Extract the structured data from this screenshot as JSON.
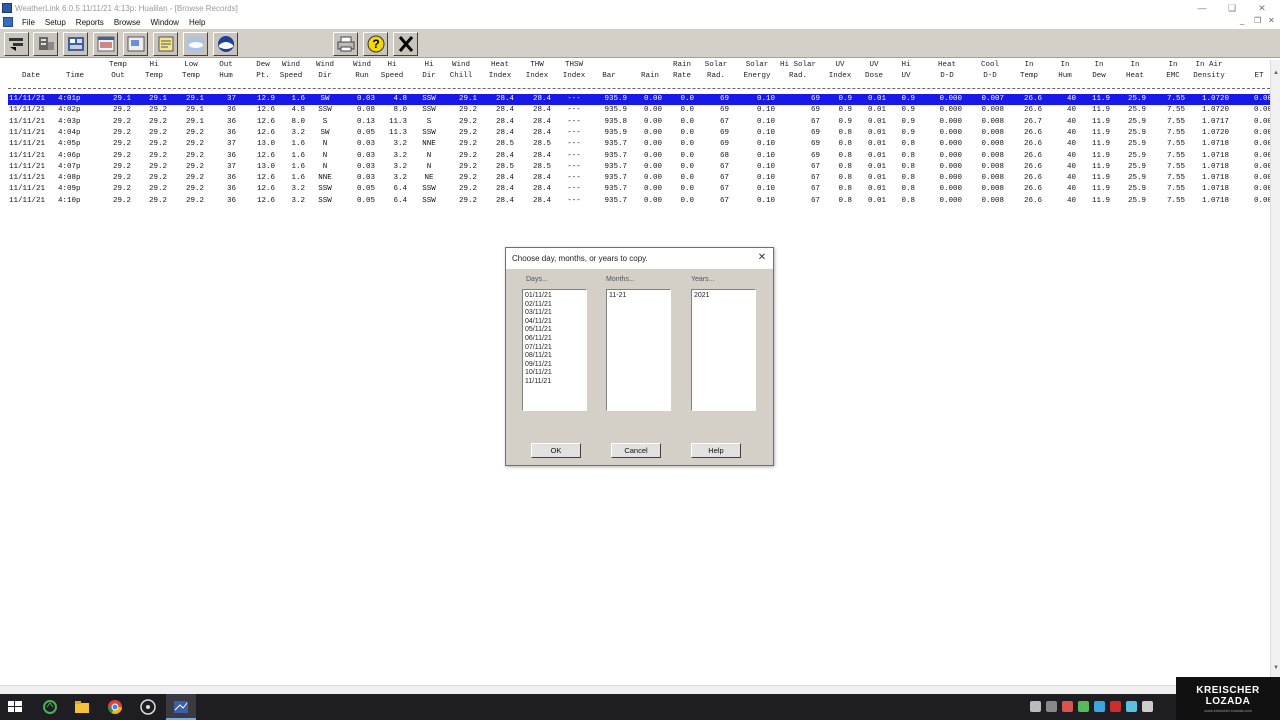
{
  "window": {
    "title": "WeatherLink 6.0.5  11/11/21   4:13p: Hualilan - [Browse Records]"
  },
  "menu": [
    "File",
    "Setup",
    "Reports",
    "Browse",
    "Window",
    "Help"
  ],
  "toolbar_icons": [
    "select-station-icon",
    "setup-icon",
    "walk-icon",
    "bulletin-icon",
    "summary-icon",
    "notes-icon",
    "noaa-weather-icon",
    "noaa-logo-icon",
    "print-icon",
    "help-icon",
    "close-icon"
  ],
  "columns": [
    {
      "l1": "",
      "l2": "Date"
    },
    {
      "l1": "",
      "l2": "Time"
    },
    {
      "l1": "Temp",
      "l2": "Out"
    },
    {
      "l1": "Hi",
      "l2": "Temp"
    },
    {
      "l1": "Low",
      "l2": "Temp"
    },
    {
      "l1": "Out",
      "l2": "Hum"
    },
    {
      "l1": "Dew",
      "l2": "Pt."
    },
    {
      "l1": "Wind",
      "l2": "Speed"
    },
    {
      "l1": "Wind",
      "l2": "Dir"
    },
    {
      "l1": "Wind",
      "l2": "Run"
    },
    {
      "l1": "Hi",
      "l2": "Speed"
    },
    {
      "l1": "Hi",
      "l2": "Dir"
    },
    {
      "l1": "Wind",
      "l2": "Chill"
    },
    {
      "l1": "Heat",
      "l2": "Index"
    },
    {
      "l1": "THW",
      "l2": "Index"
    },
    {
      "l1": "THSW",
      "l2": "Index"
    },
    {
      "l1": "",
      "l2": "Bar"
    },
    {
      "l1": "",
      "l2": "Rain"
    },
    {
      "l1": "Rain",
      "l2": "Rate"
    },
    {
      "l1": "Solar",
      "l2": "Rad."
    },
    {
      "l1": "Solar",
      "l2": "Energy"
    },
    {
      "l1": "Hi Solar",
      "l2": "Rad."
    },
    {
      "l1": "UV",
      "l2": "Index"
    },
    {
      "l1": "UV",
      "l2": "Dose"
    },
    {
      "l1": "Hi",
      "l2": "UV"
    },
    {
      "l1": "Heat",
      "l2": "D-D"
    },
    {
      "l1": "Cool",
      "l2": "D-D"
    },
    {
      "l1": "In",
      "l2": "Temp"
    },
    {
      "l1": "In",
      "l2": "Hum"
    },
    {
      "l1": "In",
      "l2": "Dew"
    },
    {
      "l1": "In",
      "l2": "Heat"
    },
    {
      "l1": "In",
      "l2": "EMC"
    },
    {
      "l1": "In Air",
      "l2": "Density"
    },
    {
      "l1": "",
      "l2": "ET"
    }
  ],
  "rows": [
    [
      "11/11/21",
      "4:01p",
      "29.1",
      "29.1",
      "29.1",
      "37",
      "12.9",
      "1.6",
      "SW",
      "0.03",
      "4.8",
      "SSW",
      "29.1",
      "28.4",
      "28.4",
      "---",
      "935.9",
      "0.00",
      "0.0",
      "69",
      "0.10",
      "69",
      "0.9",
      "0.01",
      "0.9",
      "0.000",
      "0.007",
      "26.6",
      "40",
      "11.9",
      "25.9",
      "7.55",
      "1.0720",
      "0.00"
    ],
    [
      "11/11/21",
      "4:02p",
      "29.2",
      "29.2",
      "29.1",
      "36",
      "12.6",
      "4.8",
      "SSW",
      "0.08",
      "8.0",
      "SSW",
      "29.2",
      "28.4",
      "28.4",
      "---",
      "935.9",
      "0.00",
      "0.0",
      "69",
      "0.10",
      "69",
      "0.9",
      "0.01",
      "0.9",
      "0.000",
      "0.008",
      "26.6",
      "40",
      "11.9",
      "25.9",
      "7.55",
      "1.0720",
      "0.00"
    ],
    [
      "11/11/21",
      "4:03p",
      "29.2",
      "29.2",
      "29.1",
      "36",
      "12.6",
      "8.0",
      "S",
      "0.13",
      "11.3",
      "S",
      "29.2",
      "28.4",
      "28.4",
      "---",
      "935.8",
      "0.00",
      "0.0",
      "67",
      "0.10",
      "67",
      "0.9",
      "0.01",
      "0.9",
      "0.000",
      "0.008",
      "26.7",
      "40",
      "11.9",
      "25.9",
      "7.55",
      "1.0717",
      "0.00"
    ],
    [
      "11/11/21",
      "4:04p",
      "29.2",
      "29.2",
      "29.2",
      "36",
      "12.6",
      "3.2",
      "SW",
      "0.05",
      "11.3",
      "SSW",
      "29.2",
      "28.4",
      "28.4",
      "---",
      "935.9",
      "0.00",
      "0.0",
      "69",
      "0.10",
      "69",
      "0.8",
      "0.01",
      "0.9",
      "0.000",
      "0.008",
      "26.6",
      "40",
      "11.9",
      "25.9",
      "7.55",
      "1.0720",
      "0.00"
    ],
    [
      "11/11/21",
      "4:05p",
      "29.2",
      "29.2",
      "29.2",
      "37",
      "13.0",
      "1.6",
      "N",
      "0.03",
      "3.2",
      "NNE",
      "29.2",
      "28.5",
      "28.5",
      "---",
      "935.7",
      "0.00",
      "0.0",
      "69",
      "0.10",
      "69",
      "0.8",
      "0.01",
      "0.8",
      "0.000",
      "0.008",
      "26.6",
      "40",
      "11.9",
      "25.9",
      "7.55",
      "1.0718",
      "0.00"
    ],
    [
      "11/11/21",
      "4:06p",
      "29.2",
      "29.2",
      "29.2",
      "36",
      "12.6",
      "1.6",
      "N",
      "0.03",
      "3.2",
      "N",
      "29.2",
      "28.4",
      "28.4",
      "---",
      "935.7",
      "0.00",
      "0.0",
      "68",
      "0.10",
      "69",
      "0.8",
      "0.01",
      "0.8",
      "0.000",
      "0.008",
      "26.6",
      "40",
      "11.9",
      "25.9",
      "7.55",
      "1.0718",
      "0.00"
    ],
    [
      "11/11/21",
      "4:07p",
      "29.2",
      "29.2",
      "29.2",
      "37",
      "13.0",
      "1.6",
      "N",
      "0.03",
      "3.2",
      "N",
      "29.2",
      "28.5",
      "28.5",
      "---",
      "935.7",
      "0.00",
      "0.0",
      "67",
      "0.10",
      "67",
      "0.8",
      "0.01",
      "0.8",
      "0.000",
      "0.008",
      "26.6",
      "40",
      "11.9",
      "25.9",
      "7.55",
      "1.0718",
      "0.00"
    ],
    [
      "11/11/21",
      "4:08p",
      "29.2",
      "29.2",
      "29.2",
      "36",
      "12.6",
      "1.6",
      "NNE",
      "0.03",
      "3.2",
      "NE",
      "29.2",
      "28.4",
      "28.4",
      "---",
      "935.7",
      "0.00",
      "0.0",
      "67",
      "0.10",
      "67",
      "0.8",
      "0.01",
      "0.8",
      "0.000",
      "0.008",
      "26.6",
      "40",
      "11.9",
      "25.9",
      "7.55",
      "1.0718",
      "0.00"
    ],
    [
      "11/11/21",
      "4:09p",
      "29.2",
      "29.2",
      "29.2",
      "36",
      "12.6",
      "3.2",
      "SSW",
      "0.05",
      "6.4",
      "SSW",
      "29.2",
      "28.4",
      "28.4",
      "---",
      "935.7",
      "0.00",
      "0.0",
      "67",
      "0.10",
      "67",
      "0.8",
      "0.01",
      "0.8",
      "0.000",
      "0.008",
      "26.6",
      "40",
      "11.9",
      "25.9",
      "7.55",
      "1.0718",
      "0.00"
    ],
    [
      "11/11/21",
      "4:10p",
      "29.2",
      "29.2",
      "29.2",
      "36",
      "12.6",
      "3.2",
      "SSW",
      "0.05",
      "6.4",
      "SSW",
      "29.2",
      "28.4",
      "28.4",
      "---",
      "935.7",
      "0.00",
      "0.0",
      "67",
      "0.10",
      "67",
      "0.8",
      "0.01",
      "0.8",
      "0.000",
      "0.008",
      "26.6",
      "40",
      "11.9",
      "25.9",
      "7.55",
      "1.0718",
      "0.00"
    ]
  ],
  "dialog": {
    "title": "Choose day, months, or years to copy.",
    "days_label": "Days...",
    "months_label": "Months...",
    "years_label": "Years...",
    "days": [
      "01/11/21",
      "02/11/21",
      "03/11/21",
      "04/11/21",
      "05/11/21",
      "06/11/21",
      "07/11/21",
      "08/11/21",
      "09/11/21",
      "10/11/21",
      "11/11/21"
    ],
    "months": [
      "11-21"
    ],
    "years": [
      "2021"
    ],
    "ok_label": "OK",
    "cancel_label": "Cancel",
    "help_label": "Help"
  },
  "watermark": {
    "line1": "KREISCHER",
    "line2": "LOZADA",
    "line3": "www.kreischer-lozada.com"
  },
  "colors": {
    "selection": "#1818e8",
    "toolbar_bg": "#d4d0c8",
    "taskbar_bg": "#1e1e22"
  }
}
